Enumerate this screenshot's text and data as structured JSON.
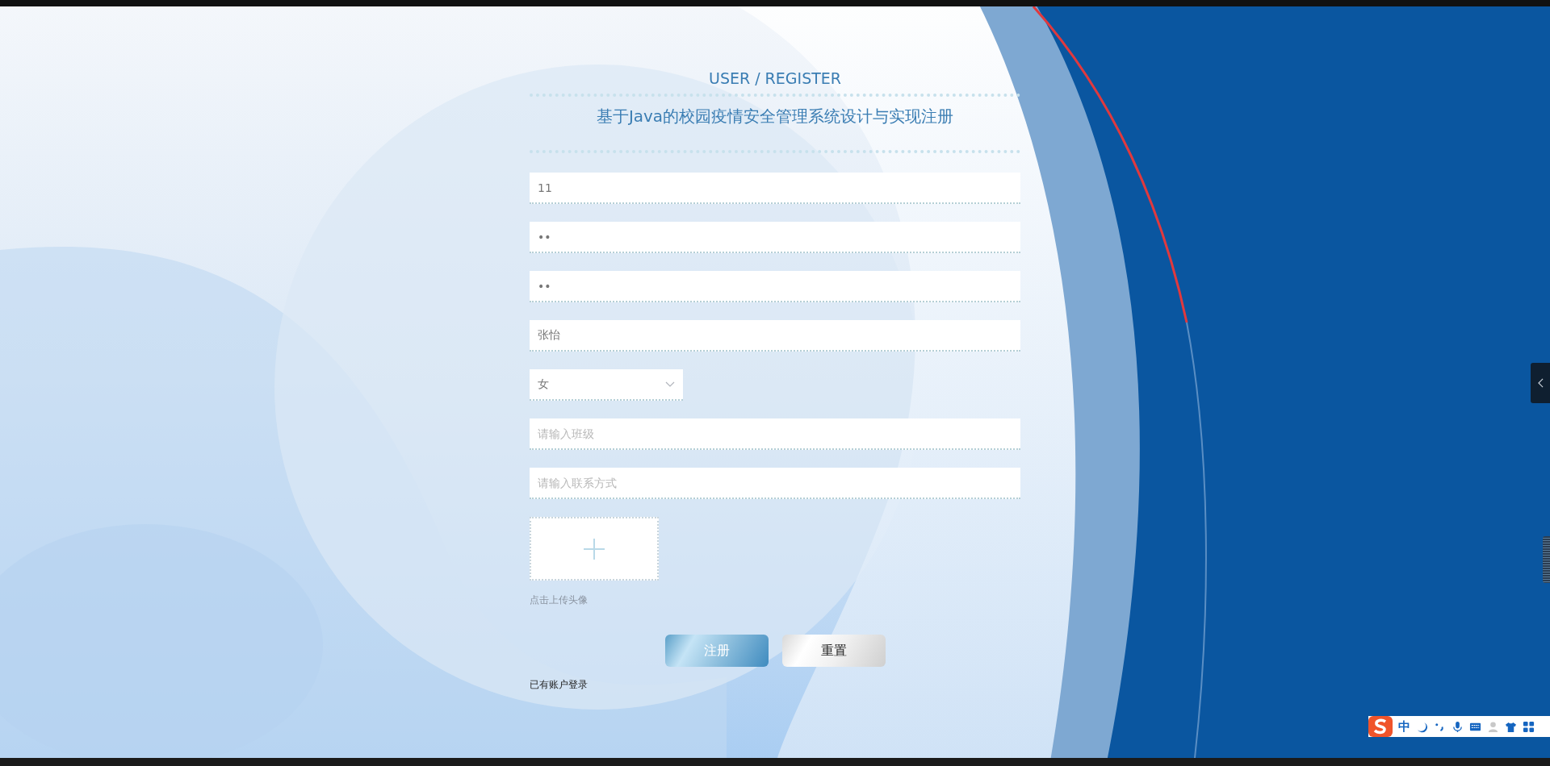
{
  "header": {
    "title": "USER / REGISTER",
    "subtitle": "基于Java的校园疫情安全管理系统设计与实现注册"
  },
  "fields": [
    {
      "kind": "text",
      "value": "11"
    },
    {
      "kind": "text",
      "value": "••"
    },
    {
      "kind": "text",
      "value": "••"
    },
    {
      "kind": "text",
      "value": "张怡"
    },
    {
      "kind": "select",
      "value": "女"
    },
    {
      "kind": "text",
      "placeholder": "请输入班级"
    },
    {
      "kind": "text",
      "placeholder": "请输入联系方式"
    }
  ],
  "upload": {
    "hint": "点击上传头像"
  },
  "buttons": [
    {
      "kind": "primary",
      "label": "注册"
    },
    {
      "kind": "secondary",
      "label": "重置"
    }
  ],
  "login_link": "已有账户登录",
  "ime_toolbar": {
    "mode": "中"
  }
}
